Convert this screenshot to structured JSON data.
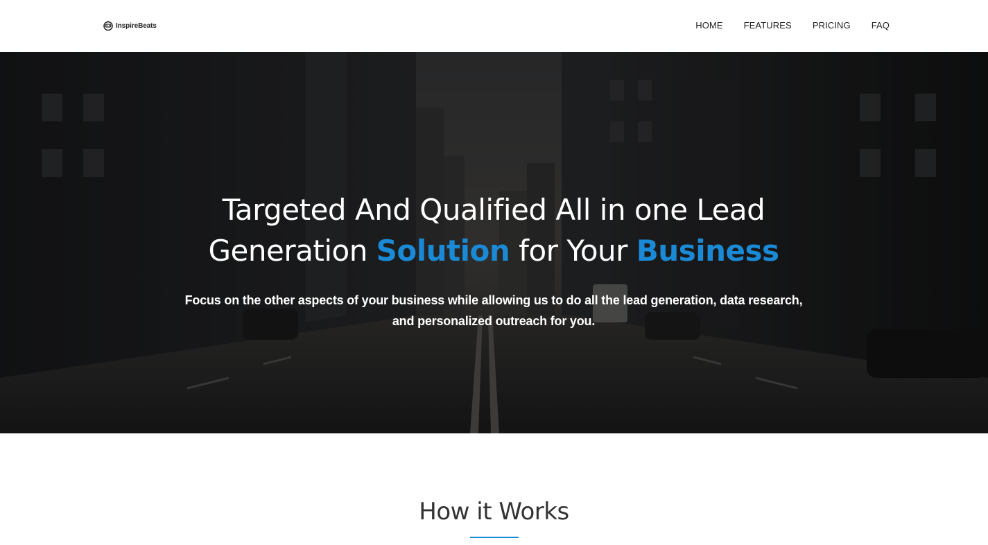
{
  "header": {
    "logo_text": "InspireBeats",
    "logo_icon": "robot-face-icon",
    "nav": [
      {
        "label": "HOME"
      },
      {
        "label": "FEATURES"
      },
      {
        "label": "PRICING"
      },
      {
        "label": "FAQ"
      }
    ]
  },
  "hero": {
    "title_part1": "Targeted And Qualified All in one Lead Generation ",
    "title_accent1": "Solution",
    "title_part2": " for Your ",
    "title_accent2": "Business",
    "subtitle": "Focus on the other aspects of your business while allowing us to do all the lead generation, data research, and personalized outreach for you.",
    "background": "dark-city-street-image"
  },
  "how_it_works": {
    "title": "How it Works"
  },
  "colors": {
    "accent": "#1a8ad6",
    "header_bg": "#ffffff",
    "hero_overlay": "#000000",
    "text_dark": "#333333"
  }
}
